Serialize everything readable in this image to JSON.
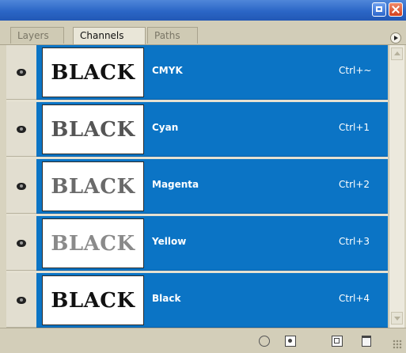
{
  "tabs": [
    {
      "label": "Layers",
      "active": false
    },
    {
      "label": "Channels",
      "active": true
    },
    {
      "label": "Paths",
      "active": false
    }
  ],
  "channels": [
    {
      "name": "CMYK",
      "shortcut": "Ctrl+~",
      "thumb_text": "BLACK",
      "thumb_color": "#111111",
      "visible": true,
      "selected": true
    },
    {
      "name": "Cyan",
      "shortcut": "Ctrl+1",
      "thumb_text": "BLACK",
      "thumb_color": "#555555",
      "visible": true,
      "selected": true
    },
    {
      "name": "Magenta",
      "shortcut": "Ctrl+2",
      "thumb_text": "BLACK",
      "thumb_color": "#6a6a6a",
      "visible": true,
      "selected": true
    },
    {
      "name": "Yellow",
      "shortcut": "Ctrl+3",
      "thumb_text": "BLACK",
      "thumb_color": "#8a8a8a",
      "visible": true,
      "selected": true
    },
    {
      "name": "Black",
      "shortcut": "Ctrl+4",
      "thumb_text": "BLACK",
      "thumb_color": "#111111",
      "visible": true,
      "selected": true
    }
  ],
  "colors": {
    "selection": "#0b74c5",
    "titlebar": "#2b66c6",
    "panel": "#d8d3bf"
  },
  "icons": {
    "footer": [
      "load-channel-as-selection-icon",
      "save-selection-as-channel-icon",
      "new-channel-icon",
      "delete-channel-icon"
    ]
  }
}
